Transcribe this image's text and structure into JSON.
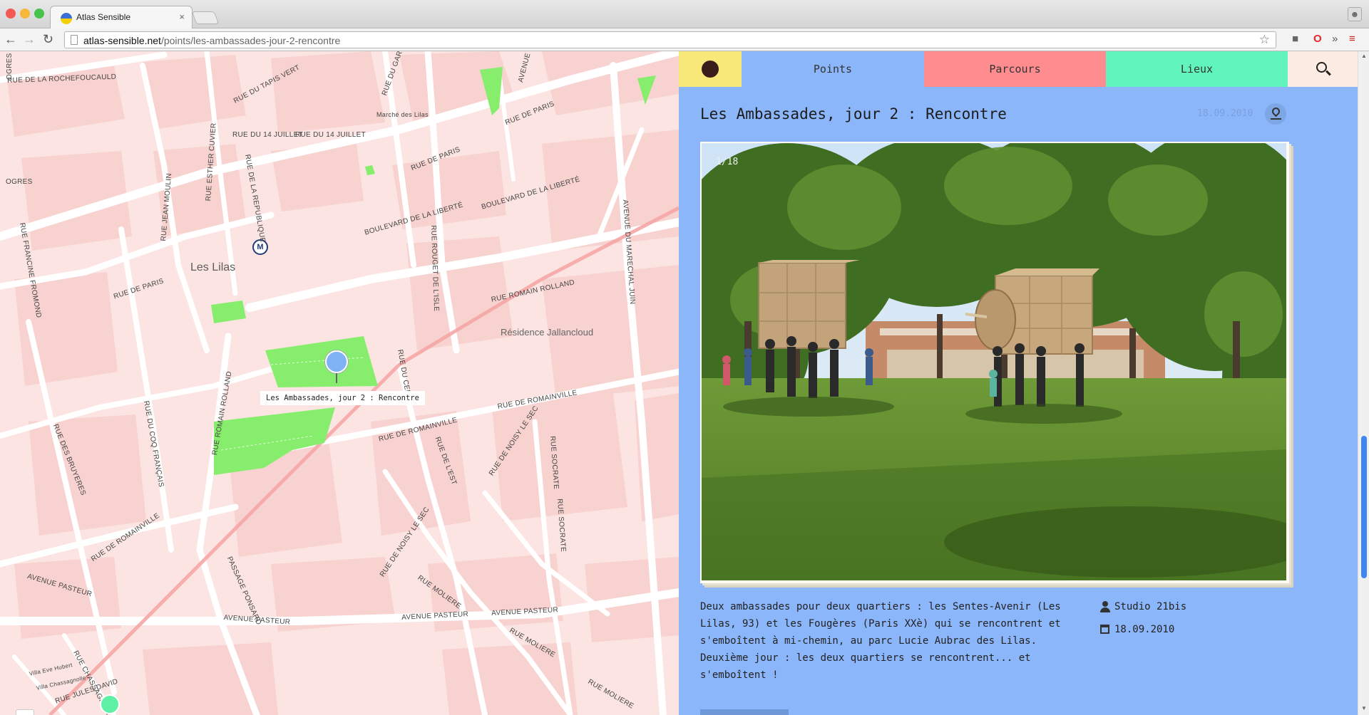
{
  "browser": {
    "tab_title": "Atlas Sensible",
    "tab_close": "×",
    "url_domain": "atlas-sensible.net",
    "url_path": "/points/les-ambassades-jour-2-rencontre",
    "toolbar_icons": [
      "back-icon",
      "forward-icon",
      "reload-icon",
      "star-icon",
      "puzzle-icon",
      "opera-icon",
      "overflow-icon",
      "menu-icon"
    ],
    "user_icon": "user-icon"
  },
  "map": {
    "place_main": "Les Lilas",
    "place_residence": "Résidence Jallancloud",
    "market": "Marché des Lilas",
    "metro_label": "M",
    "marker_tag": "Les Ambassades, jour 2 : Rencontre",
    "zoom_in": "+",
    "zoom_out": "-",
    "streets": {
      "rochefoucauld": "RUE DE LA ROCHEFOUCAULD",
      "tapis_vert": "RUE DU TAPIS VERT",
      "garde_chasse": "RUE DU GARDE CHASSE",
      "avenue": "AVENUE",
      "rue_de_paris_1": "RUE DE PARIS",
      "rue_de_paris_2": "RUE DE PARIS",
      "rue_de_paris_3": "RUE DE PARIS",
      "juillet": "RUE DU 14 JUILLET",
      "juillet2": "RUE DU 14 JUILLET",
      "cuvier": "RUE ESTHER CUVIER",
      "republique": "RUE DE LA REPUBLIQUE",
      "jean_moulin": "RUE JEAN MOULIN",
      "liberte_1": "BOULEVARD DE LA LIBERTÉ",
      "liberte_2": "BOULEVARD DE LA LIBERTÉ",
      "rouget": "RUE ROUGET DE L'ISLE",
      "marechal_juin": "AVENUE DU MARECHAL JUIN",
      "fromond": "RUE FRANCINE FROMOND",
      "romain_rolland_1": "RUE ROMAIN ROLLAND",
      "romain_rolland_2": "RUE ROMAIN ROLLAND",
      "romainville_1": "RUE DE ROMAINVILLE",
      "romainville_2": "RUE DE ROMAINVILLE",
      "romainville_3": "RUE DE ROMAINVILLE",
      "coq_francais": "RUE DU COQ FRANÇAIS",
      "bruyeres": "RUE DES BRUYERES",
      "rue_de_lest": "RUE DE L'EST",
      "noisy_1": "RUE DE NOISY LE SEC",
      "noisy_2": "RUE DE NOISY LE SEC",
      "socrate_1": "RUE SOCRATE",
      "socrate_2": "RUE SOCRATE",
      "ponsard": "PASSAGE PONSARD",
      "pasteur_1": "AVENUE PASTEUR",
      "pasteur_2": "AVENUE PASTEUR",
      "pasteur_3": "AVENUE PASTEUR",
      "pasteur_4": "AVENUE PASTEUR",
      "moliere_1": "RUE MOLIERE",
      "moliere_2": "RUE MOLIERE",
      "moliere_3": "RUE MOLIERE",
      "chassagnolle": "RUE CHASSAGNOLLE",
      "jules_david": "RUE JULES DAVID",
      "rue_du_cen": "RUE DU CEN",
      "ogres": "OGRES",
      "villa_eve": "Villa Eve Hubert",
      "villa_chassagnolle": "Villa Chassagnolle"
    }
  },
  "panel": {
    "nav": {
      "points": "Points",
      "parcours": "Parcours",
      "lieux": "Lieux"
    },
    "title": "Les Ambassades, jour 2 : Rencontre",
    "date_top": "18.09.2010",
    "photo_counter": "1/18",
    "description_1": "Deux ambassades pour deux quartiers : les Sentes-Avenir (Les Lilas, 93) et les Fougères (Paris XXè) qui se rencontrent et s'emboîtent à mi-chemin, au parc Lucie Aubrac des Lilas.",
    "description_2": "Deuxième jour : les deux quartiers se rencontrent... et s'emboîtent !",
    "author": "Studio 21bis",
    "date": "18.09.2010"
  },
  "colors": {
    "home": "#f8e87a",
    "points": "#8cb6fa",
    "parcours": "#ff8c8f",
    "lieux": "#61f5bd",
    "search": "#fcece4",
    "map_bg": "#fbe4e1",
    "park": "#86ee6c"
  }
}
